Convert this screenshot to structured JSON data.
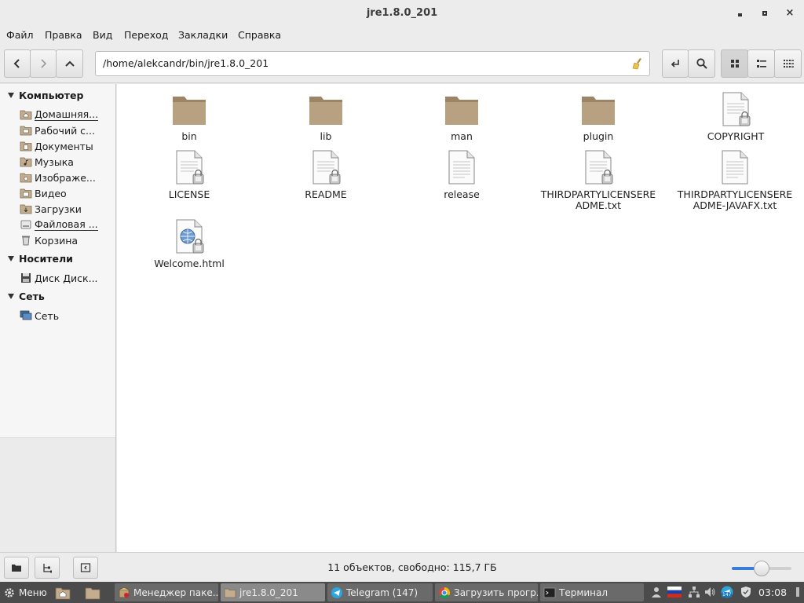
{
  "window": {
    "title": "jre1.8.0_201",
    "controls": {
      "minimize": "minimize",
      "maximize": "maximize",
      "close": "×"
    }
  },
  "menubar": {
    "items": [
      "Файл",
      "Правка",
      "Вид",
      "Переход",
      "Закладки",
      "Справка"
    ]
  },
  "toolbar": {
    "address": "/home/alekcandr/bin/jre1.8.0_201",
    "view_mode": "icons"
  },
  "sidebar": {
    "sections": [
      {
        "title": "Компьютер",
        "items": [
          {
            "label": "Домашняя...",
            "icon": "home-folder-icon",
            "underline": true
          },
          {
            "label": "Рабочий с...",
            "icon": "desktop-folder-icon",
            "underline": false
          },
          {
            "label": "Документы",
            "icon": "documents-folder-icon",
            "underline": false
          },
          {
            "label": "Музыка",
            "icon": "music-folder-icon",
            "underline": false
          },
          {
            "label": "Изображе...",
            "icon": "pictures-folder-icon",
            "underline": false
          },
          {
            "label": "Видео",
            "icon": "videos-folder-icon",
            "underline": false
          },
          {
            "label": "Загрузки",
            "icon": "downloads-folder-icon",
            "underline": false
          },
          {
            "label": "Файловая ...",
            "icon": "filesystem-icon",
            "underline": true
          },
          {
            "label": "Корзина",
            "icon": "trash-icon",
            "underline": false
          }
        ]
      },
      {
        "title": "Носители",
        "items": [
          {
            "label": "Диск Диск...",
            "icon": "disk-icon",
            "underline": false
          }
        ]
      },
      {
        "title": "Сеть",
        "items": [
          {
            "label": "Сеть",
            "icon": "network-icon",
            "underline": false
          }
        ]
      }
    ]
  },
  "files": [
    {
      "name": "bin",
      "type": "folder",
      "locked": false
    },
    {
      "name": "lib",
      "type": "folder",
      "locked": false
    },
    {
      "name": "man",
      "type": "folder",
      "locked": false
    },
    {
      "name": "plugin",
      "type": "folder",
      "locked": false
    },
    {
      "name": "COPYRIGHT",
      "type": "text",
      "locked": true
    },
    {
      "name": "LICENSE",
      "type": "text",
      "locked": true
    },
    {
      "name": "README",
      "type": "text",
      "locked": true
    },
    {
      "name": "release",
      "type": "text",
      "locked": false
    },
    {
      "name": "THIRDPARTYLICENSERE ADME.txt",
      "type": "text",
      "locked": true
    },
    {
      "name": "THIRDPARTYLICENSERE ADME-JAVAFX.txt",
      "type": "text",
      "locked": false
    },
    {
      "name": "Welcome.html",
      "type": "html",
      "locked": true
    }
  ],
  "statusbar": {
    "text": "11 объектов, свободно: 115,7 ГБ",
    "zoom_level": 0.5
  },
  "taskbar": {
    "menu_label": "Меню",
    "windows": [
      {
        "label": "Менеджер паке...",
        "icon": "package-manager-icon",
        "active": false
      },
      {
        "label": "jre1.8.0_201",
        "icon": "folder-icon",
        "active": true
      },
      {
        "label": "Telegram (147)",
        "icon": "telegram-icon",
        "active": false
      },
      {
        "label": "Загрузить прогр...",
        "icon": "chrome-icon",
        "active": false
      },
      {
        "label": "Терминал",
        "icon": "terminal-icon",
        "active": false
      }
    ],
    "clock": "03:08",
    "tray_badge": "147"
  },
  "colors": {
    "folder": "#b39c80",
    "accent": "#3a7dd6",
    "taskbar": "#4b4b4b"
  }
}
